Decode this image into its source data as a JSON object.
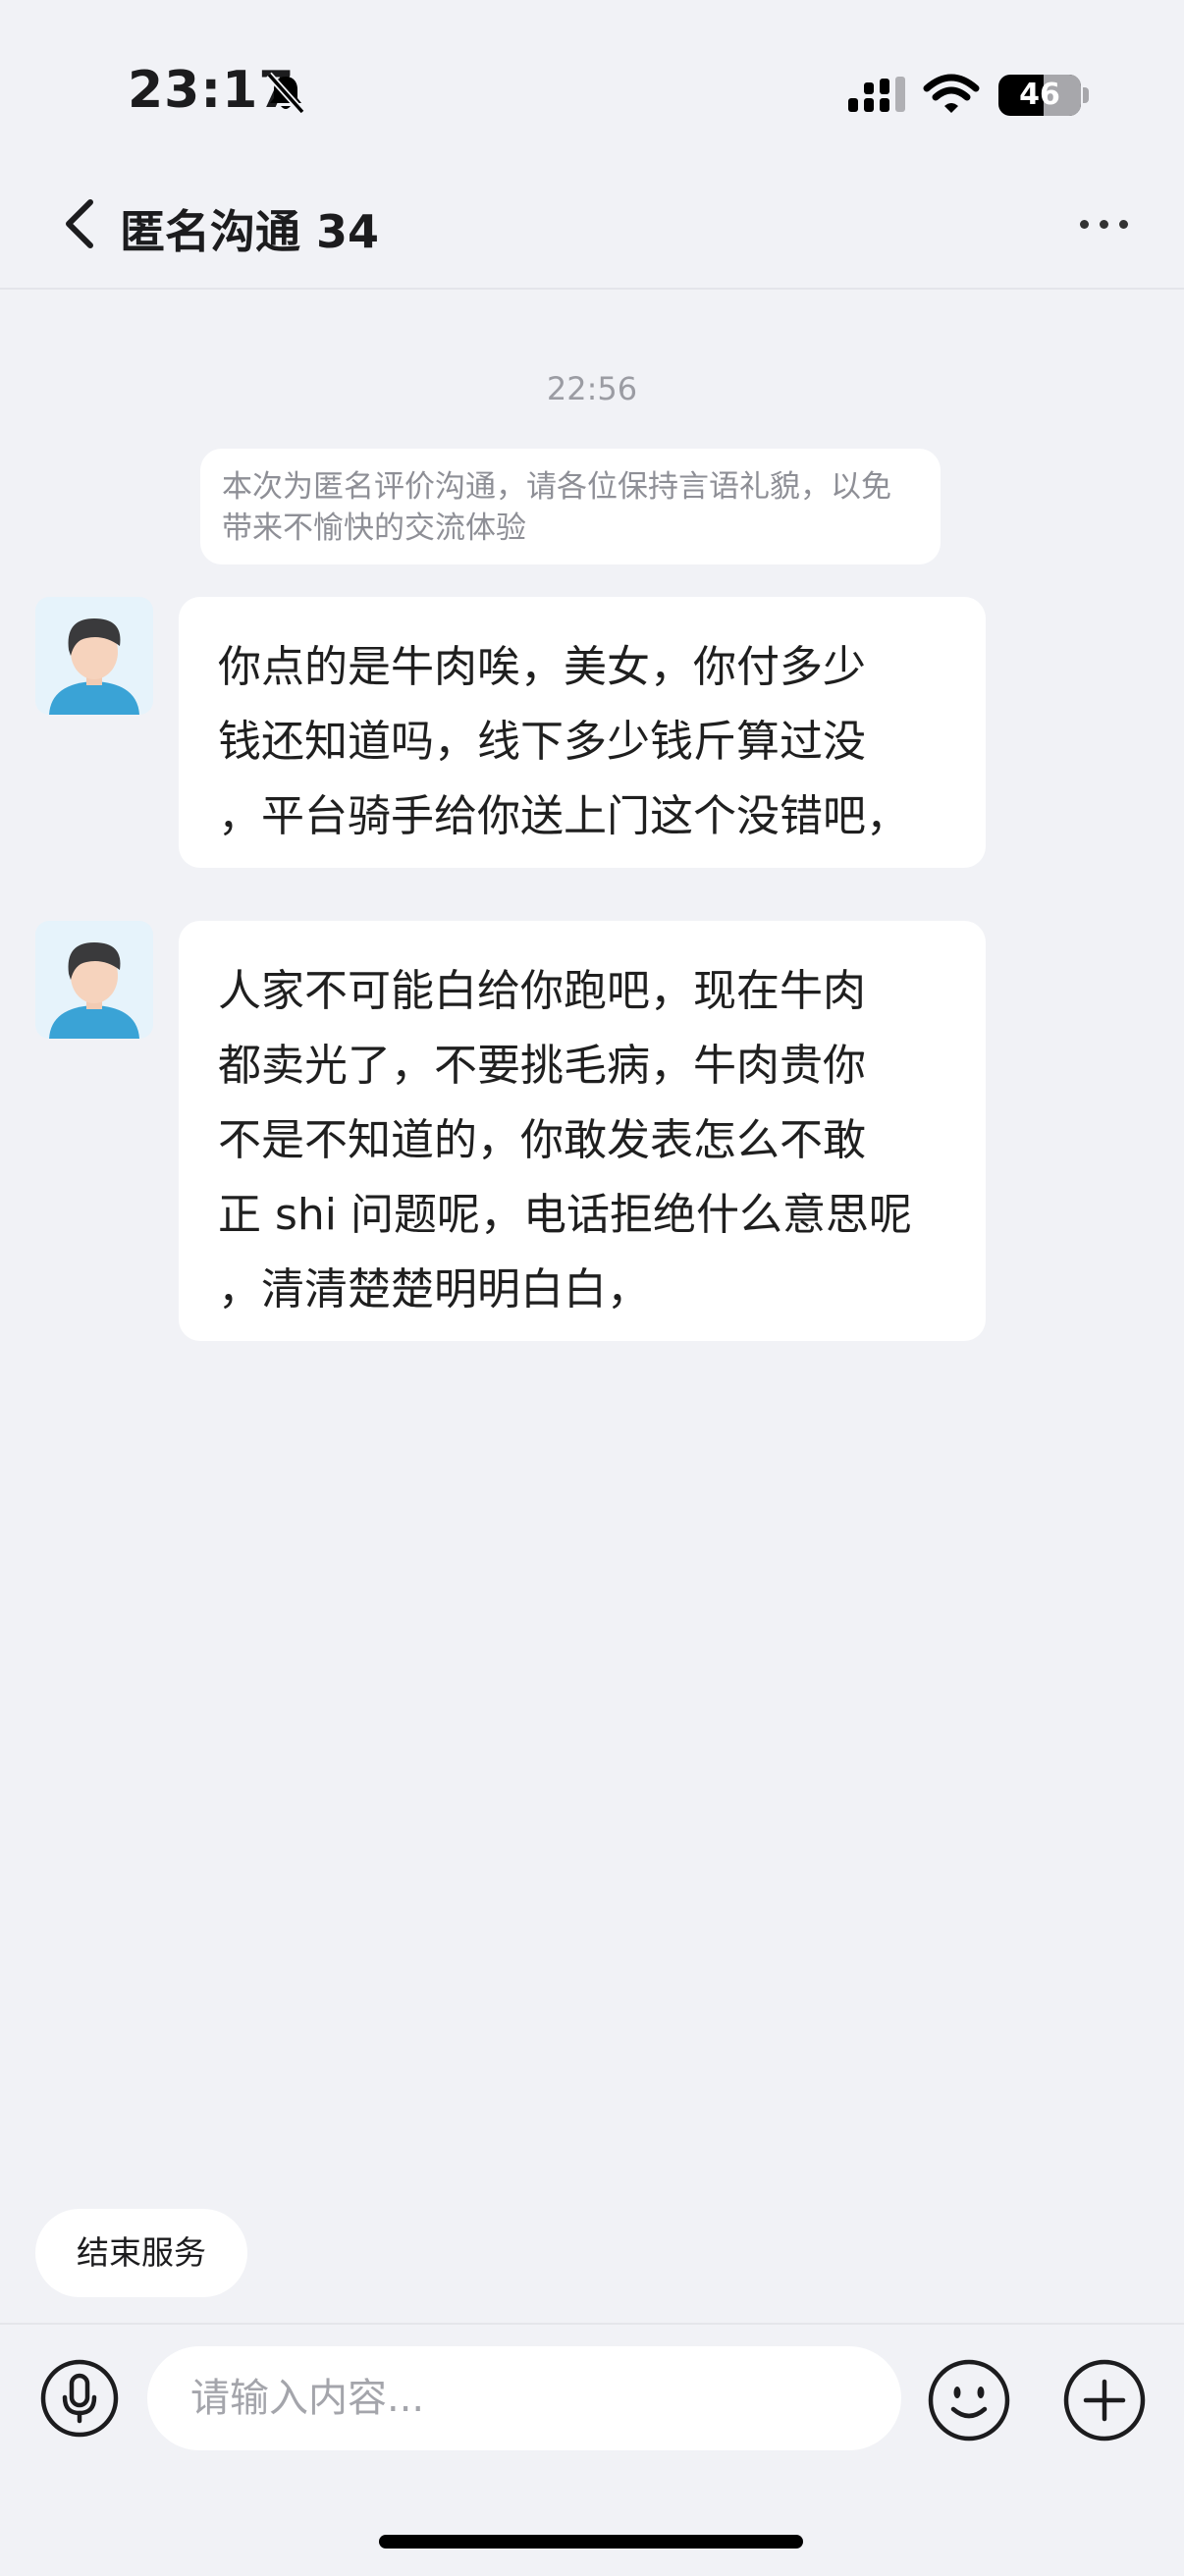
{
  "status_bar": {
    "time": "23:17",
    "battery": "46",
    "icons": [
      "bell-slash-icon",
      "cellular-signal-icon",
      "wifi-icon",
      "battery-icon"
    ]
  },
  "nav": {
    "title": "匿名沟通 34",
    "back_icon": "chevron-left-icon",
    "more_icon": "ellipsis-icon"
  },
  "chat": {
    "timestamp": "22:56",
    "notice": "本次为匿名评价沟通，请各位保持言语礼貌，以免带来不愉快的交流体验",
    "messages": [
      {
        "text": "你点的是牛肉唉，美女，你付多少\n钱还知道吗，线下多少钱斤算过没\n，平台骑手给你送上门这个没错吧，"
      },
      {
        "text": "人家不可能白给你跑吧，现在牛肉\n都卖光了，不要挑毛病，牛肉贵你\n不是不知道的，你敢发表怎么不敢\n正 shi 问题呢，电话拒绝什么意思呢\n，清清楚楚明明白白，"
      }
    ]
  },
  "actions": {
    "end_service": "结束服务"
  },
  "input_bar": {
    "placeholder": "请输入内容...",
    "mic_icon": "microphone-icon",
    "emoji_icon": "smiley-icon",
    "add_icon": "plus-circle-icon"
  },
  "colors": {
    "background": "#f1f2f6",
    "bubble": "#ffffff",
    "muted_text": "#9b9ca3",
    "avatar_shirt": "#3aa3d6"
  }
}
